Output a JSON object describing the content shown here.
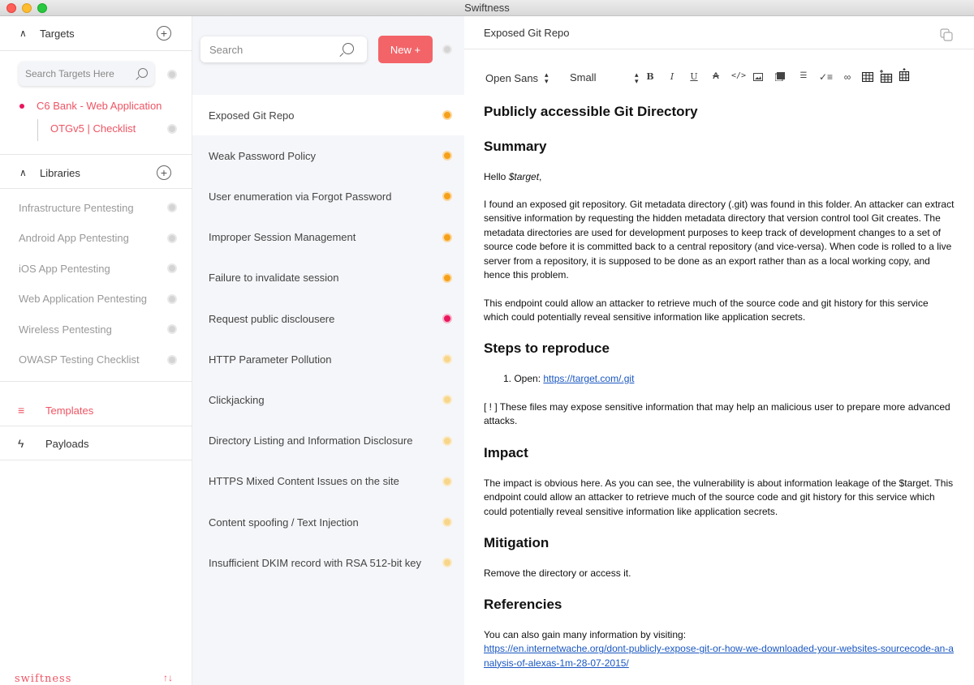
{
  "window": {
    "title": "Swiftness"
  },
  "sidebar": {
    "targets_label": "Targets",
    "search_placeholder": "Search Targets Here",
    "target_name": "C6 Bank - Web Application",
    "checklist_name": "OTGv5 | Checklist",
    "libraries_label": "Libraries",
    "libraries": [
      "Infrastructure Pentesting",
      "Android App Pentesting",
      "iOS App Pentesting",
      "Web Application Pentesting",
      "Wireless Pentesting",
      "OWASP Testing Checklist"
    ],
    "nav": {
      "templates": "Templates",
      "payloads": "Payloads"
    },
    "brand": "swiftness",
    "colors": {
      "accent": "#ee5463",
      "target_dot": "#e8175d"
    }
  },
  "list": {
    "search_placeholder": "Search",
    "new_button": "New +",
    "items": [
      {
        "label": "Exposed Git Repo",
        "severity": "medium",
        "color": "#f5a01a"
      },
      {
        "label": "Weak Password Policy",
        "severity": "medium",
        "color": "#f5a01a"
      },
      {
        "label": "User enumeration via Forgot Password",
        "severity": "medium",
        "color": "#f5a01a"
      },
      {
        "label": "Improper Session Management",
        "severity": "medium",
        "color": "#f5a01a"
      },
      {
        "label": "Failure to invalidate session",
        "severity": "medium",
        "color": "#f5a01a"
      },
      {
        "label": "Request public disclousere",
        "severity": "high",
        "color": "#e8175d"
      },
      {
        "label": "HTTP Parameter Pollution",
        "severity": "low",
        "color": "#f7d58a"
      },
      {
        "label": "Clickjacking",
        "severity": "low",
        "color": "#f7d58a"
      },
      {
        "label": "Directory Listing and Information Disclosure",
        "severity": "low",
        "color": "#f7d58a"
      },
      {
        "label": "HTTPS Mixed Content Issues on the site",
        "severity": "low",
        "color": "#f7d58a"
      },
      {
        "label": "Content spoofing / Text Injection",
        "severity": "low",
        "color": "#f7d58a"
      },
      {
        "label": "Insufficient DKIM record with RSA 512-bit key",
        "severity": "low",
        "color": "#f7d58a"
      }
    ],
    "selected_index": 0
  },
  "editor": {
    "title": "Exposed Git Repo",
    "toolbar": {
      "font": "Open Sans",
      "size": "Small",
      "buttons": [
        "bold",
        "italic",
        "underline",
        "clear-format",
        "code",
        "image",
        "video",
        "ordered-list",
        "checklist",
        "link",
        "table",
        "table-insert-row",
        "table-insert-col"
      ]
    },
    "doc": {
      "heading": "Publicly accessible Git Directory",
      "summary_h": "Summary",
      "greeting_prefix": "Hello ",
      "greeting_var": "$target",
      "greeting_suffix": ",",
      "summary_p1": "I found an exposed git repository. Git metadata directory (.git) was found in this folder. An attacker can extract sensitive information by requesting the hidden metadata directory that version control tool Git creates. The metadata directories are used for development purposes to keep track of development changes to a set of source code before it is committed back to a central repository (and vice-versa). When code is rolled to a live server from a repository, it is supposed to be done as an export rather than as a local working copy, and hence this problem.",
      "summary_p2": "This endpoint could allow an attacker to retrieve much of the source code and git history for this service which could potentially reveal sensitive information like application secrets.",
      "steps_h": "Steps to reproduce",
      "step1_prefix": "1.  Open: ",
      "step1_link": "https://target.com/.git",
      "steps_note": "[ ! ] These files may expose sensitive information that may help an malicious user to prepare more advanced attacks.",
      "impact_h": "Impact",
      "impact_p": "The impact is obvious here. As you can see, the vulnerability is about information leakage of the $target. This endpoint could allow an attacker to retrieve much of the source code and git history for this service which could potentially reveal sensitive information like application secrets.",
      "mitigation_h": "Mitigation",
      "mitigation_p": "Remove the directory or access it.",
      "references_h": "Referencies",
      "references_p": "You can also gain many information by visiting:",
      "references_link": "https://en.internetwache.org/dont-publicly-expose-git-or-how-we-downloaded-your-websites-sourcecode-an-analysis-of-alexas-1m-28-07-2015/"
    }
  }
}
